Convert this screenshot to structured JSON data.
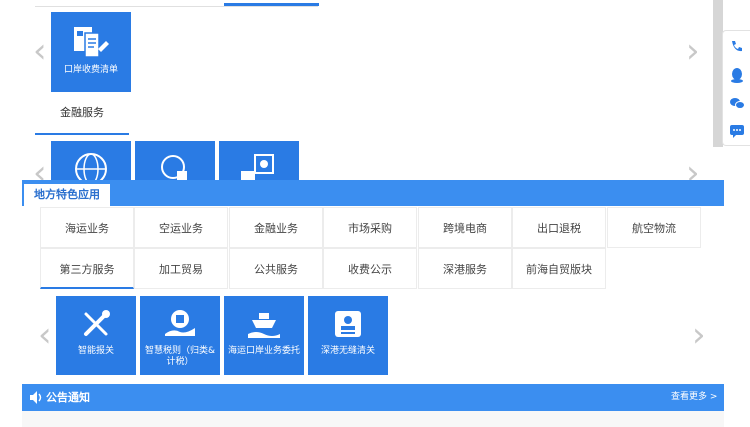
{
  "top_carousel": {
    "tile_label": "口岸收费清单"
  },
  "finance": {
    "tab_label": "金融服务"
  },
  "local_apps": {
    "section_title": "地方特色应用",
    "tabs_row1": [
      "海运业务",
      "空运业务",
      "金融业务",
      "市场采购",
      "跨境电商",
      "出口退税",
      "航空物流"
    ],
    "tabs_row2": [
      "第三方服务",
      "加工贸易",
      "公共服务",
      "收费公示",
      "深港服务",
      "前海自贸版块"
    ],
    "active_tab": "第三方服务",
    "tiles": [
      {
        "label_line1": "智能报关",
        "label_line2": "",
        "icon": "tools-icon"
      },
      {
        "label_line1": "智慧税则（归类&",
        "label_line2": "计税）",
        "icon": "tax-hand-icon"
      },
      {
        "label_line1": "海运口岸业务委托",
        "label_line2": "",
        "icon": "ship-hand-icon"
      },
      {
        "label_line1": "深港无缝清关",
        "label_line2": "",
        "icon": "id-card-icon"
      }
    ]
  },
  "notice": {
    "title": "公告通知",
    "more": "查看更多 >"
  },
  "side_tools": [
    "phone-icon",
    "qq-icon",
    "wechat-icon",
    "message-icon"
  ],
  "colors": {
    "primary": "#2a7be4",
    "bar": "#3b8ef0"
  }
}
